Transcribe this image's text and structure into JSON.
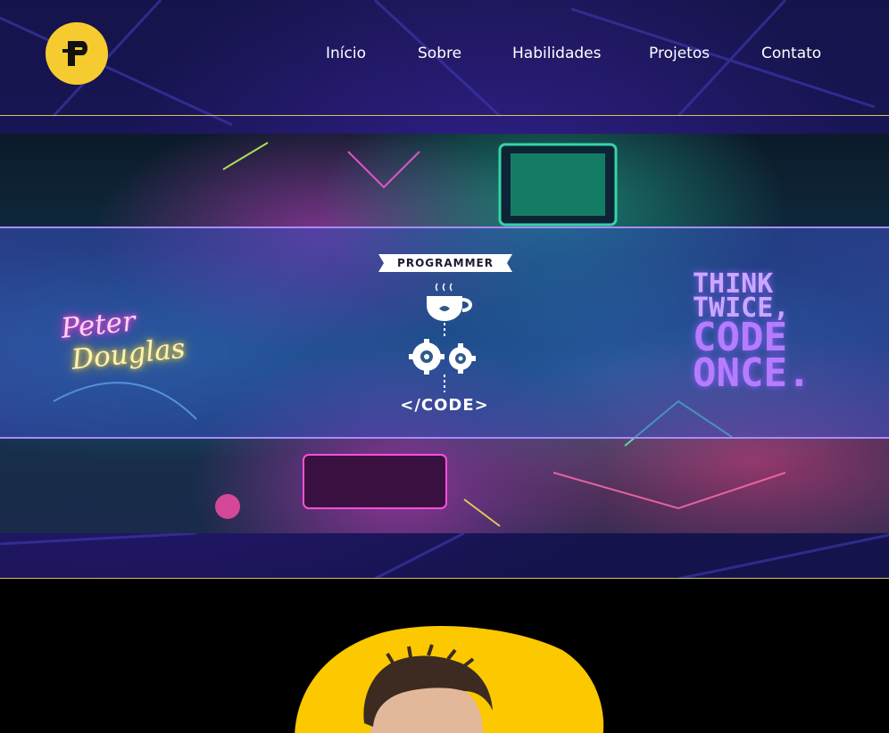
{
  "brand": {
    "logo_letter": "P",
    "logo_color": "#f6cb2f"
  },
  "nav": {
    "items": [
      {
        "label": "Início"
      },
      {
        "label": "Sobre"
      },
      {
        "label": "Habilidades"
      },
      {
        "label": "Projetos"
      },
      {
        "label": "Contato"
      }
    ]
  },
  "banner": {
    "name_line1": "Peter",
    "name_line2": "Douglas",
    "badge": "PROGRAMMER",
    "code_tag": "</CODE>",
    "slogan_line1": "THINK",
    "slogan_line2": "TWICE,",
    "slogan_line3": "CODE",
    "slogan_line4": "ONCE."
  },
  "about": {
    "avatar_bg_color": "#fcc800"
  }
}
